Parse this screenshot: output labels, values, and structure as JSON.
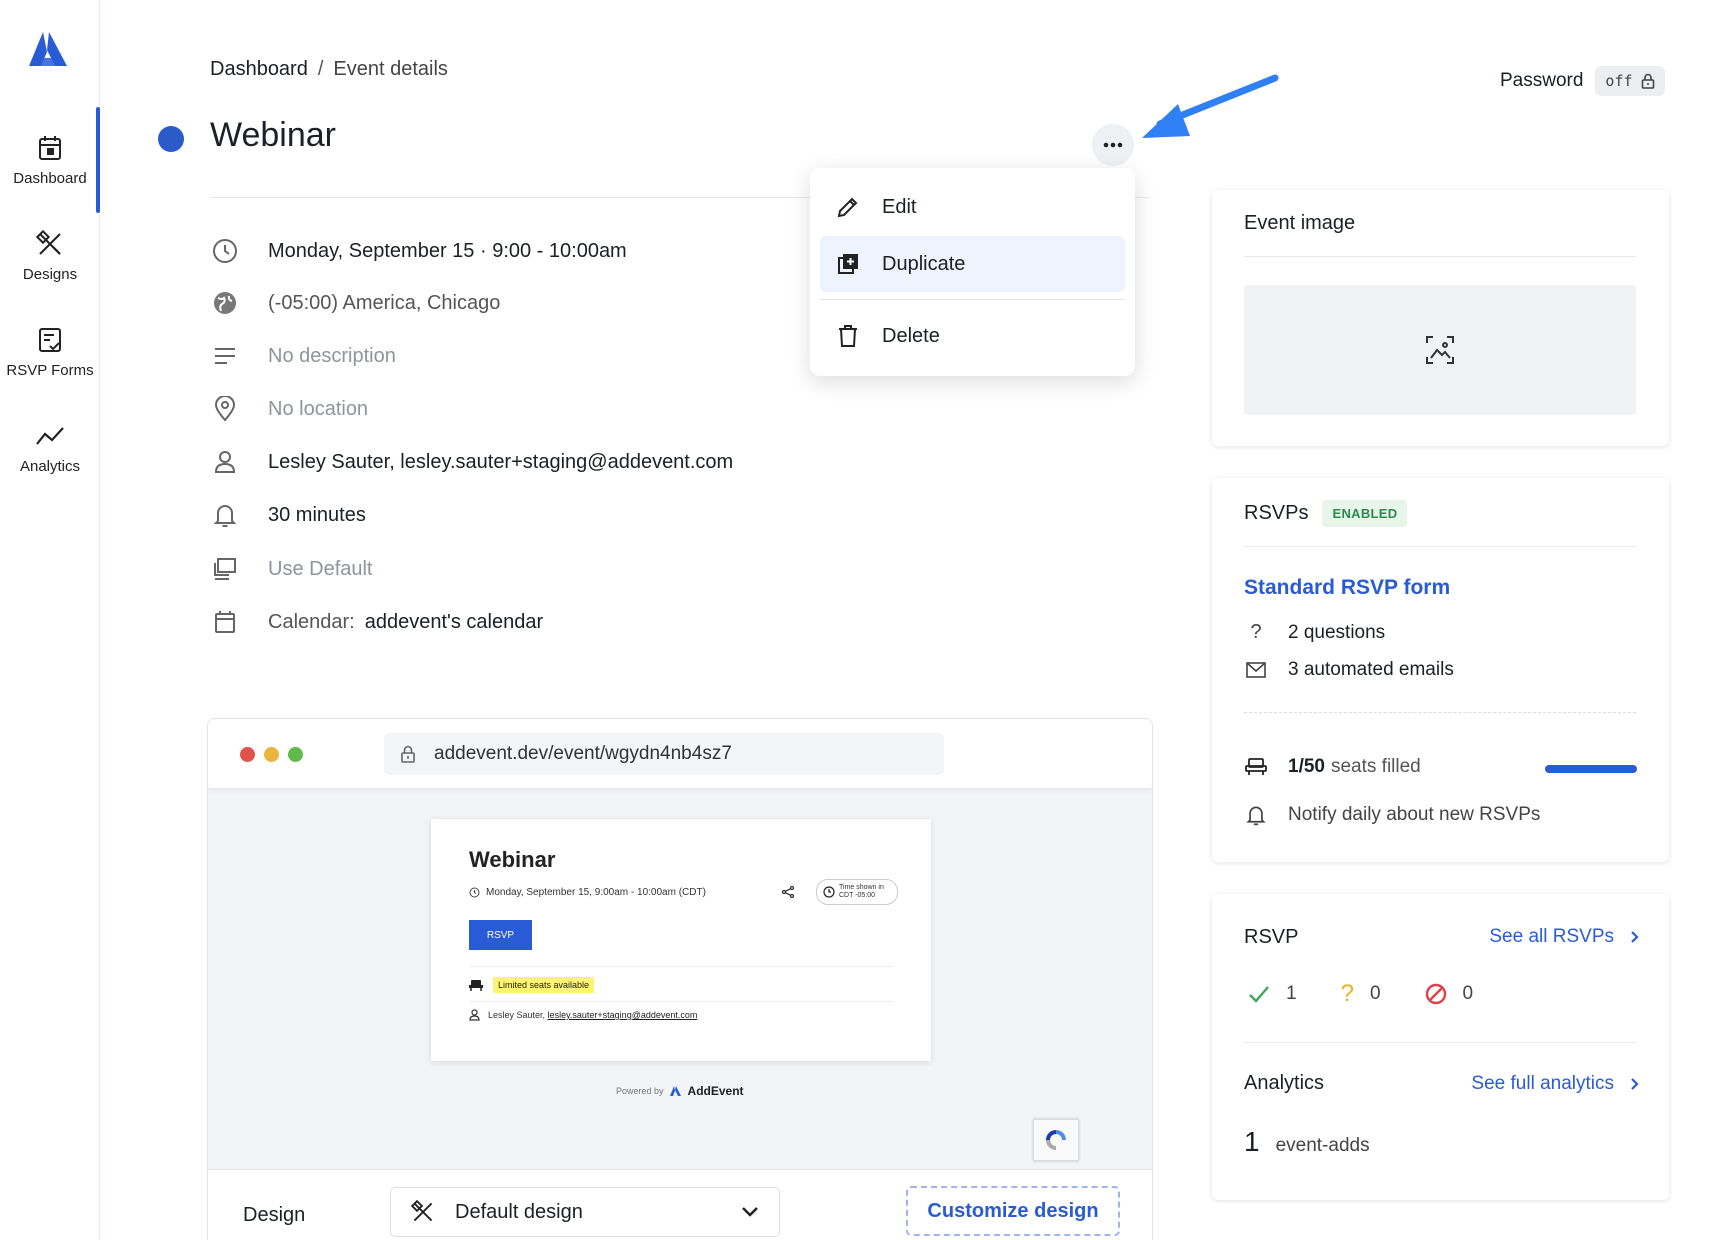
{
  "sidebar": {
    "items": [
      {
        "label": "Dashboard",
        "icon": "calendar-icon",
        "active": true
      },
      {
        "label": "Designs",
        "icon": "design-tools-icon"
      },
      {
        "label": "RSVP Forms",
        "icon": "form-check-icon"
      },
      {
        "label": "Analytics",
        "icon": "analytics-line-icon"
      }
    ]
  },
  "header": {
    "breadcrumb": [
      "Dashboard",
      "/",
      "Event details"
    ],
    "password_label": "Password",
    "password_value": "off",
    "title": "Webinar",
    "title_color": "#2c5bc9"
  },
  "details": {
    "datetime": "Monday, September 15 · 9:00 - 10:00am",
    "timezone": "(-05:00) America, Chicago",
    "description": "No description",
    "location": "No location",
    "organizer": "Lesley Sauter, lesley.sauter+staging@addevent.com",
    "reminder": "30 minutes",
    "conference": "Use Default",
    "calendar_label": "Calendar:",
    "calendar_value": "addevent's calendar"
  },
  "menu": {
    "items": [
      {
        "label": "Edit",
        "icon": "pencil-icon"
      },
      {
        "label": "Duplicate",
        "icon": "duplicate-icon",
        "highlighted": true
      },
      {
        "label": "Delete",
        "icon": "trash-icon"
      }
    ]
  },
  "preview": {
    "url": "addevent.dev/event/wgydn4nb4sz7",
    "card_title": "Webinar",
    "card_date": "Monday, September 15, 9:00am - 10:00am (CDT)",
    "tz_line1": "Time shown in",
    "tz_line2": "CDT -05:00",
    "rsvp_button": "RSVP",
    "seats_badge": "Limited seats available",
    "person_name": "Lesley Sauter,",
    "person_email": "lesley.sauter+staging@addevent.com",
    "powered_by": "Powered by",
    "brand": "AddEvent",
    "design_label": "Design",
    "design_value": "Default design",
    "customize_button": "Customize design"
  },
  "event_image": {
    "title": "Event image"
  },
  "rsvps": {
    "title": "RSVPs",
    "badge": "ENABLED",
    "form_link": "Standard RSVP form",
    "questions": "2 questions",
    "emails": "3 automated emails",
    "seats_count": "1/50",
    "seats_text": "seats filled",
    "seats_fraction": 0.02,
    "notify": "Notify daily about new RSVPs"
  },
  "rsvp_summary": {
    "title": "RSVP",
    "see_all": "See all RSVPs",
    "yes": "1",
    "maybe": "0",
    "no": "0",
    "analytics_title": "Analytics",
    "see_analytics": "See full analytics",
    "event_adds_count": "1",
    "event_adds_label": "event-adds"
  },
  "colors": {
    "accent": "#2a5bd7",
    "enabled_green": "#2d8a4e"
  }
}
